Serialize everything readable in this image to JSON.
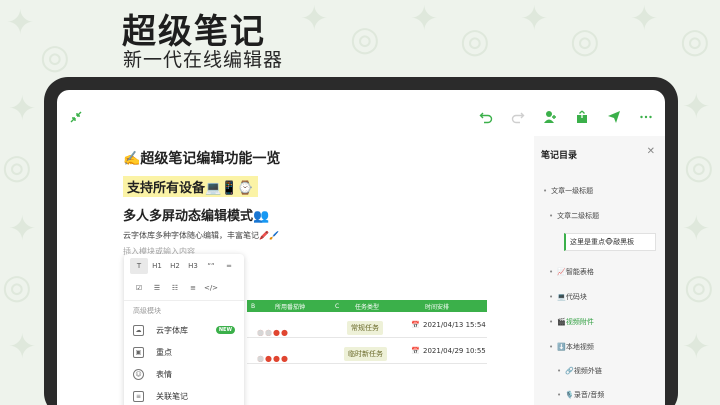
{
  "hero": {
    "title": "超级笔记",
    "subtitle": "新一代在线编辑器"
  },
  "colors": {
    "accent": "#3bb04a",
    "background": "#eef3ec",
    "device": "#2b2b2b",
    "highlight": "#fbf3a6"
  },
  "toolbar": {
    "collapse_icon": "collapse-arrows-icon",
    "actions": [
      "undo-icon",
      "redo-icon",
      "add-member-icon",
      "share-icon",
      "send-icon",
      "more-icon"
    ]
  },
  "document": {
    "heading1": "✍️超级笔记编辑功能一览",
    "heading2": "支持所有设备💻📱⌚",
    "heading3": "多人多屏动态编辑模式👥",
    "note_line": "云字体库多种字体随心编辑，丰富笔记🖍️🖌️",
    "placeholder": "插入模块或输入内容"
  },
  "table": {
    "columns": [
      "B",
      "所用番茄钟",
      "C",
      "任务类型",
      "时间安排"
    ],
    "rows": [
      {
        "tag": "常规任务",
        "date": "2021/04/13 15:54",
        "tomatoes_filled": 4,
        "tomatoes_empty": 2
      },
      {
        "tag": "临时新任务",
        "date": "2021/04/29 10:55",
        "tomatoes_filled": 4,
        "tomatoes_empty": 1
      }
    ]
  },
  "block_menu": {
    "format_row1": [
      "T",
      "H1",
      "H2",
      "H3",
      "““",
      "═"
    ],
    "format_row2": [
      "☑",
      "☰",
      "☷",
      "≡",
      "</>"
    ],
    "section_label": "高级模块",
    "items": [
      {
        "label": "云字体库",
        "badge": "NEW",
        "icon": "cloud-icon"
      },
      {
        "label": "重点",
        "icon": "highlight-icon"
      },
      {
        "label": "表情",
        "icon": "emoji-icon"
      },
      {
        "label": "关联笔记",
        "icon": "link-note-icon"
      }
    ]
  },
  "toc": {
    "title": "笔记目录",
    "items": [
      {
        "label": "文章一级标题"
      },
      {
        "label": "文章二级标题"
      },
      {
        "label": "这里是重点🐵敲黑板"
      },
      {
        "label": "📈智能表格"
      },
      {
        "label": "💻代码块"
      },
      {
        "label": "🎬视频附件"
      },
      {
        "label": "⬇️本地视频"
      },
      {
        "label": "🔗视频外链"
      },
      {
        "label": "🎙️录音/音频"
      }
    ]
  }
}
